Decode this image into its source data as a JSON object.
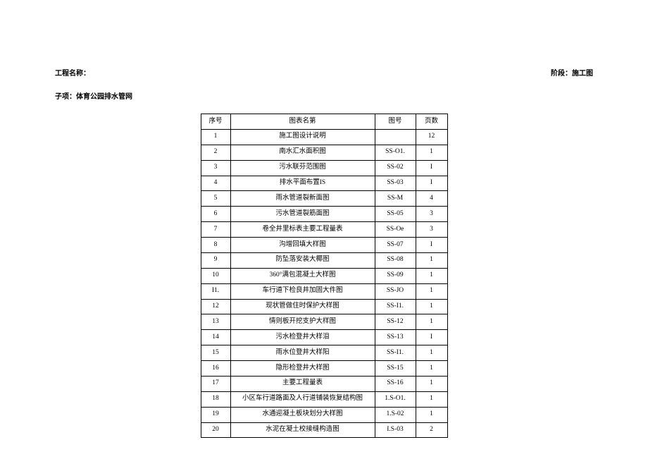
{
  "header": {
    "project_label": "工程名称：",
    "phase_label": "阶段：施工图"
  },
  "subitem": "子项：体育公园排水管网",
  "table": {
    "headers": {
      "seq": "序号",
      "name": "图表名第",
      "code": "图号",
      "pages": "页数"
    },
    "rows": [
      {
        "seq": "1",
        "name": "施工图设计说明",
        "code": "",
        "pages": "12"
      },
      {
        "seq": "2",
        "name": "南水汇水面积图",
        "code": "SS-O1.",
        "pages": "1"
      },
      {
        "seq": "3",
        "name": "污水联芬范围图",
        "code": "SS-02",
        "pages": "I"
      },
      {
        "seq": "4",
        "name": "排水平面布置IS",
        "code": "SS-03",
        "pages": "I"
      },
      {
        "seq": "5",
        "name": "雨水管道裂新面图",
        "code": "SS-M",
        "pages": "4"
      },
      {
        "seq": "6",
        "name": "污水管道裂筋面图",
        "code": "SS-05",
        "pages": "3"
      },
      {
        "seq": "7",
        "name": "卷全井里标表主要工程量表",
        "code": "SS-Oe",
        "pages": "3"
      },
      {
        "seq": "8",
        "name": "沟增回填大样图",
        "code": "SS-07",
        "pages": "I"
      },
      {
        "seq": "9",
        "name": "防坠落安装大椰图",
        "code": "SS-08",
        "pages": "1"
      },
      {
        "seq": "10",
        "name": "360°满包混凝土大样图",
        "code": "SS-09",
        "pages": "1"
      },
      {
        "seq": "I1.",
        "name": "车行道下检良井加固大件图",
        "code": "SS-JO",
        "pages": "1"
      },
      {
        "seq": "12",
        "name": "现状管做住时保护大样图",
        "code": "SS-I1.",
        "pages": "1"
      },
      {
        "seq": "13",
        "name": "情则板开挖支护大样图",
        "code": "SS-12",
        "pages": "1"
      },
      {
        "seq": "14",
        "name": "污水检登井大样泪",
        "code": "SS-13",
        "pages": "I"
      },
      {
        "seq": "15",
        "name": "雨水位登井大样阳",
        "code": "SS-I1.",
        "pages": "1"
      },
      {
        "seq": "16",
        "name": "隐形检登井大样图",
        "code": "SS-15",
        "pages": "1"
      },
      {
        "seq": "17",
        "name": "主要工程量表",
        "code": "SS-16",
        "pages": "1"
      },
      {
        "seq": "18",
        "name": "小区车行道路面及人行道铺装恢复结构图",
        "code": "1.S-O1.",
        "pages": "1"
      },
      {
        "seq": "19",
        "name": "水通迎凝土板块划分大样图",
        "code": "1.S-02",
        "pages": "1"
      },
      {
        "seq": "20",
        "name": "水泥在凝土校接缝构造图",
        "code": "I.S-03",
        "pages": "2"
      }
    ]
  }
}
